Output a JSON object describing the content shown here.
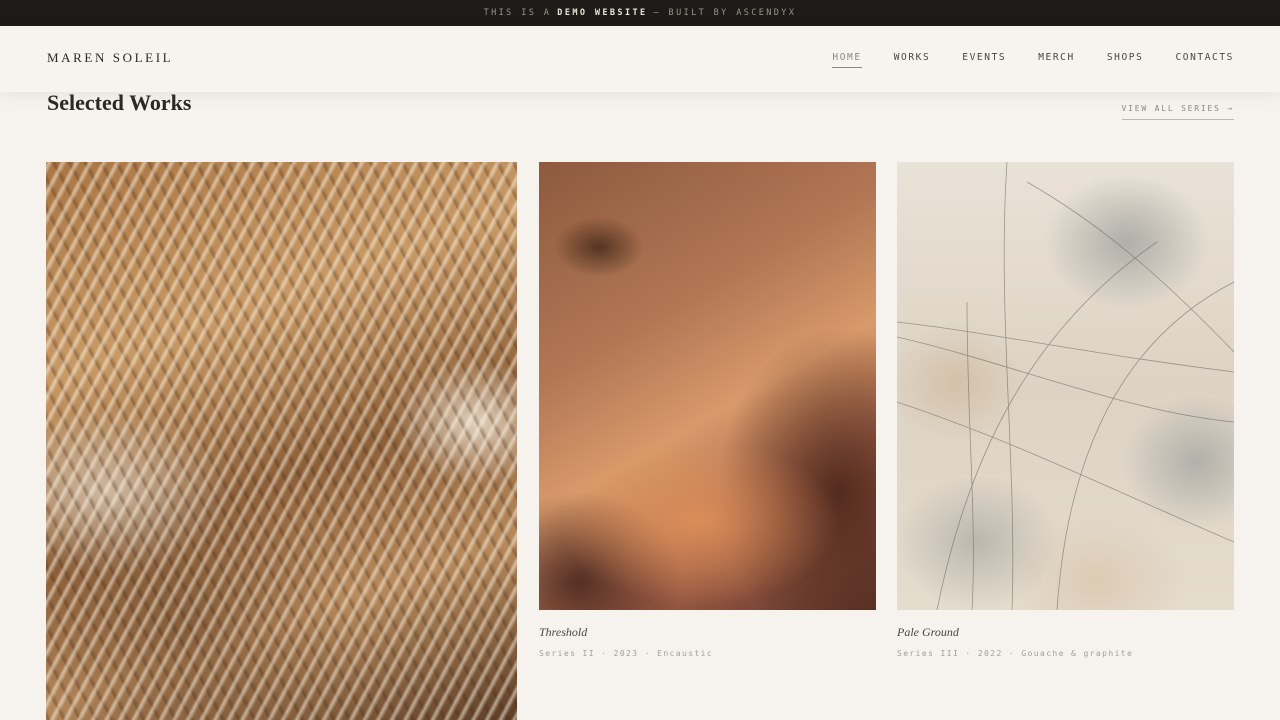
{
  "banner": {
    "prefix": "THIS IS A",
    "highlight": "DEMO WEBSITE",
    "suffix": "— BUILT BY ASCENDYX"
  },
  "header": {
    "brand": "MAREN SOLEIL",
    "nav": [
      "HOME",
      "WORKS",
      "EVENTS",
      "MERCH",
      "SHOPS",
      "CONTACTS"
    ],
    "active": "HOME"
  },
  "section": {
    "title": "Selected Works",
    "view_all": "VIEW ALL SERIES →"
  },
  "works": [
    {
      "title": "Threshold",
      "meta": "Series II · 2023 · Encaustic"
    },
    {
      "title": "Pale Ground",
      "meta": "Series III · 2022 · Gouache & graphite"
    }
  ],
  "colors": {
    "banner_bg": "#1d1b18",
    "page_bg": "#f6f3ee",
    "text": "#2a2622"
  }
}
